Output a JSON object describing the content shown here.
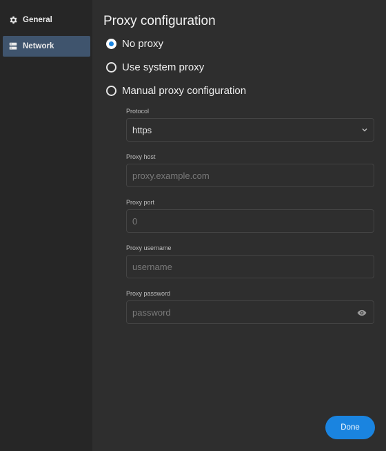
{
  "sidebar": {
    "items": [
      {
        "label": "General",
        "icon": "gear-icon",
        "active": false
      },
      {
        "label": "Network",
        "icon": "server-icon",
        "active": true
      }
    ]
  },
  "main": {
    "title": "Proxy configuration",
    "options": [
      {
        "label": "No proxy",
        "checked": true
      },
      {
        "label": "Use system proxy",
        "checked": false
      },
      {
        "label": "Manual proxy configuration",
        "checked": false
      }
    ],
    "fields": {
      "protocol": {
        "label": "Protocol",
        "value": "https"
      },
      "host": {
        "label": "Proxy host",
        "placeholder": "proxy.example.com"
      },
      "port": {
        "label": "Proxy port",
        "placeholder": "0"
      },
      "username": {
        "label": "Proxy username",
        "placeholder": "username"
      },
      "password": {
        "label": "Proxy password",
        "placeholder": "password"
      }
    },
    "done_label": "Done"
  },
  "colors": {
    "accent": "#1a84e0",
    "sidebar_active": "#3f546d",
    "background": "#2e2e2e",
    "sidebar_background": "#262626"
  }
}
